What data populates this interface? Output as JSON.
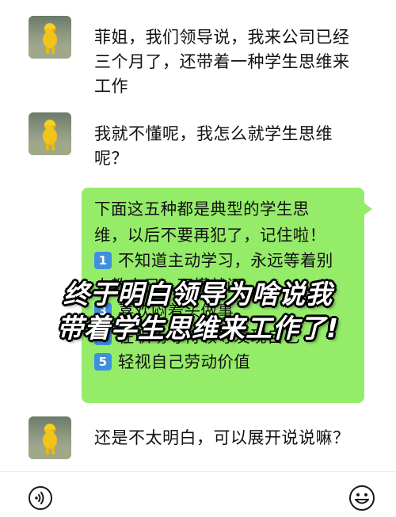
{
  "messages": [
    {
      "text": "菲姐，我们领导说，我来公司已经三个月了，还带着一种学生思维来工作"
    },
    {
      "text": "我就不懂呢，我怎么就学生思维呢？"
    },
    {
      "text": "还是不太明白，可以展开说说嘛？"
    }
  ],
  "reply": {
    "line1": "下面这五种都是典型的学生思",
    "line2": "维，以后不要再犯了，记住啦！",
    "items": [
      {
        "num": "1",
        "text": "不知道主动学习，永远等着别"
      },
      {
        "num": "2",
        "text": "人教自己，不懂就问"
      },
      {
        "num": "3",
        "text": "喜欢闷着头做事。"
      },
      {
        "num": "4",
        "text": "在职场等待领导发现自己"
      },
      {
        "num": "5",
        "text": "轻视自己劳动价值"
      }
    ]
  },
  "overlay": {
    "line1": "终于明白领导为啥说我",
    "line2": "带着学生思维来工作了!"
  },
  "bottom_bar": {
    "left_icon": "voice-icon",
    "right_icon": "emoji-icon"
  },
  "colors": {
    "bubble": "#95ec69",
    "badge": "#3f8fe0"
  }
}
